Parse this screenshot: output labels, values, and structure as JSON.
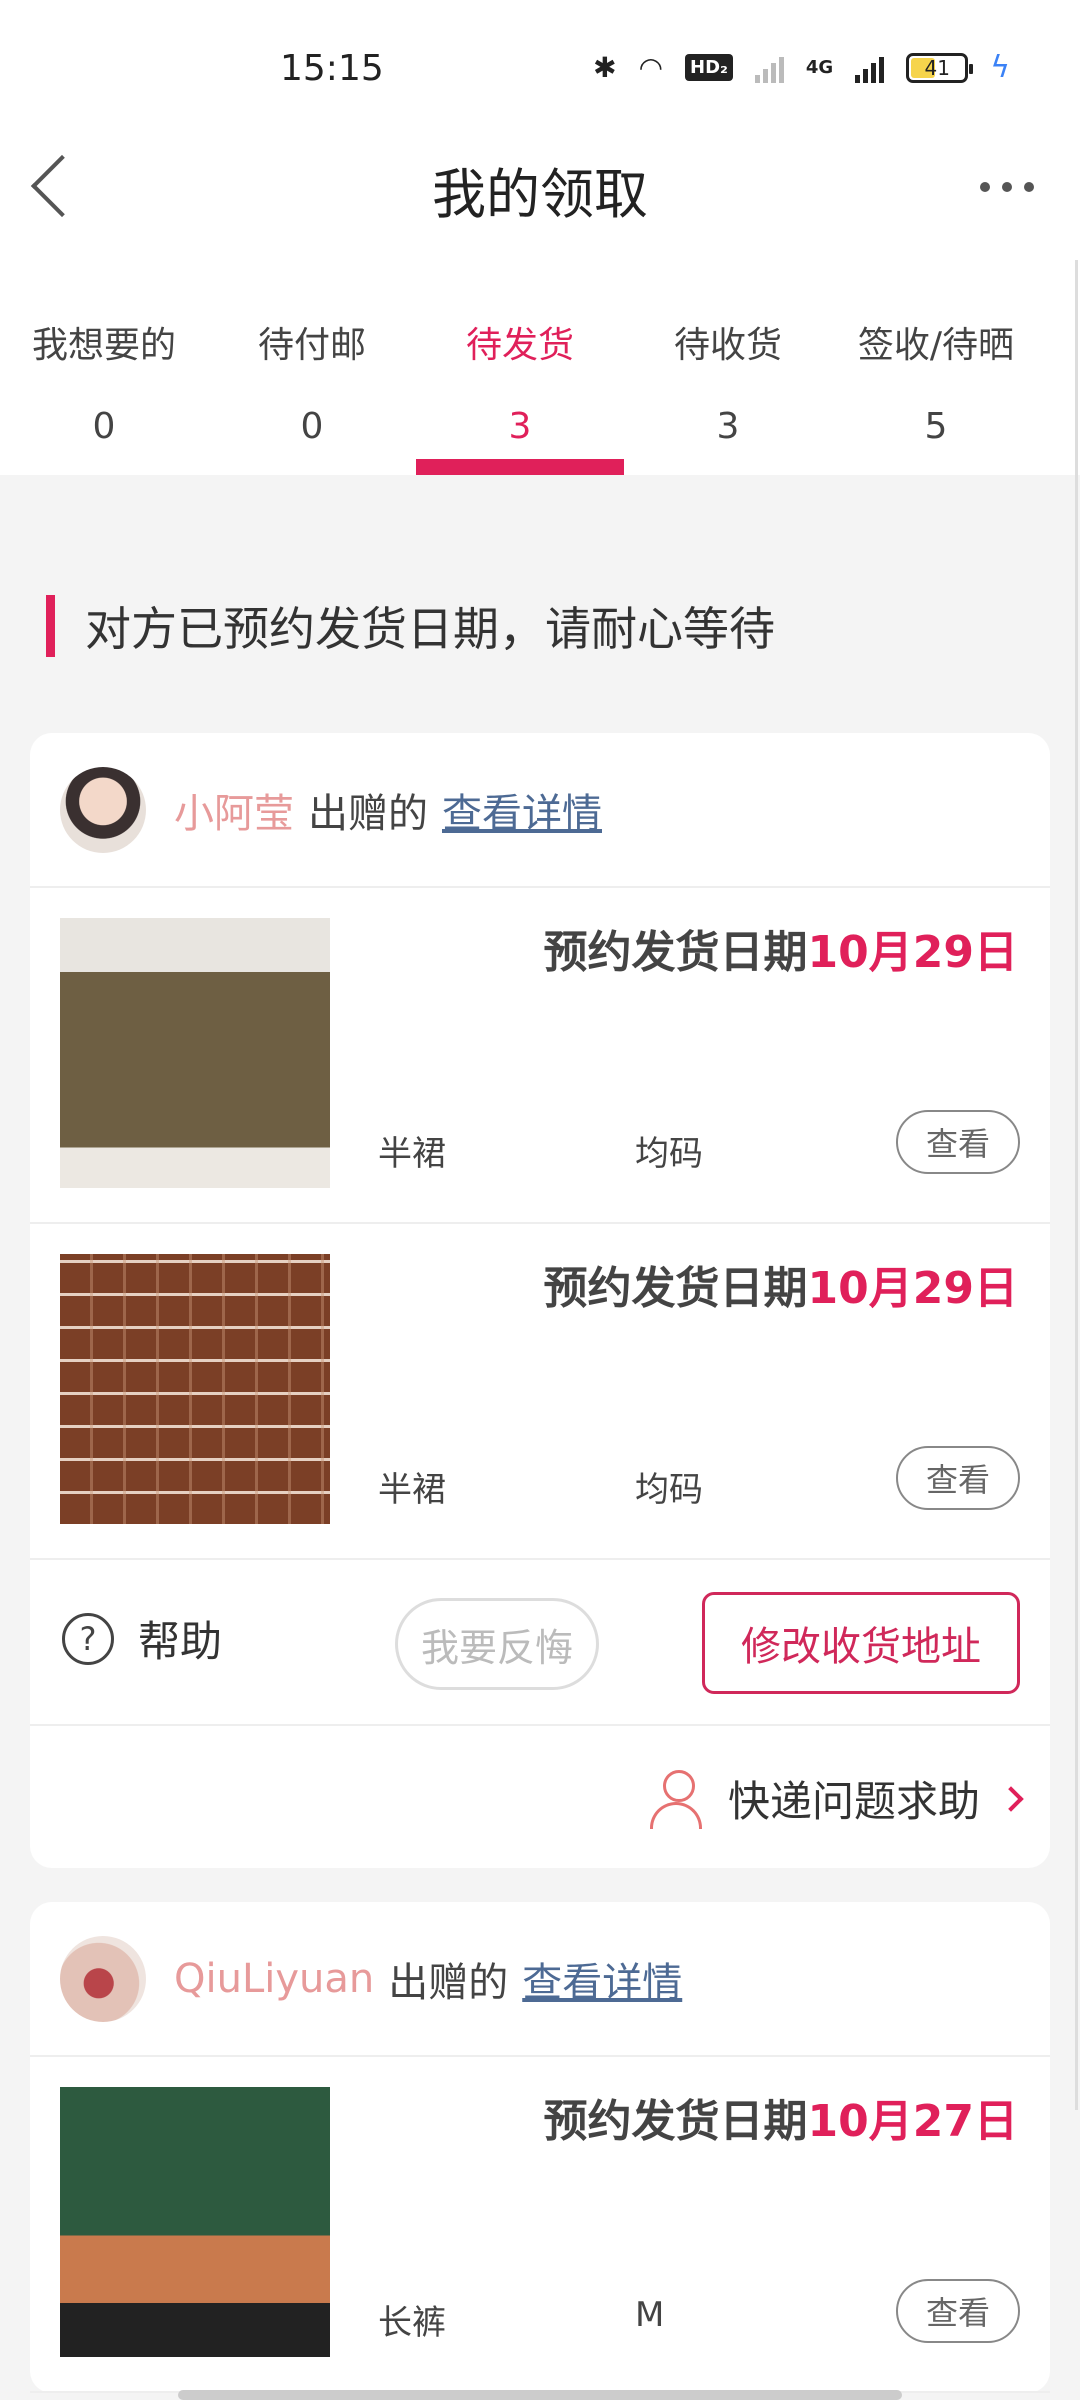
{
  "status_bar": {
    "time": "15:15",
    "hd_badge": "HD₂",
    "network": "4G",
    "battery": "41",
    "icons": [
      "bluetooth-icon",
      "wifi-icon",
      "signal-icon",
      "battery-icon",
      "charging-icon"
    ]
  },
  "header": {
    "title": "我的领取"
  },
  "tabs": [
    {
      "label": "我想要的",
      "count": "0"
    },
    {
      "label": "待付邮",
      "count": "0"
    },
    {
      "label": "待发货",
      "count": "3",
      "active": true
    },
    {
      "label": "待收货",
      "count": "3"
    },
    {
      "label": "签收/待晒",
      "count": "5"
    }
  ],
  "notice": "对方已预约发货日期，请耐心等待",
  "colors": {
    "accent": "#e0205a",
    "giver_name": "#e79a9a",
    "link": "#4d6a94"
  },
  "cards": [
    {
      "giver": "小阿莹",
      "gave_text": "出赠的",
      "detail_link": "查看详情",
      "items": [
        {
          "ship_label": "预约发货日期",
          "ship_date": "10月29日",
          "category": "半裙",
          "size": "均码",
          "view_label": "查看"
        },
        {
          "ship_label": "预约发货日期",
          "ship_date": "10月29日",
          "category": "半裙",
          "size": "均码",
          "view_label": "查看"
        }
      ],
      "help_label": "帮助",
      "regret_label": "我要反悔",
      "address_label": "修改收货地址",
      "express_label": "快递问题求助"
    },
    {
      "giver": "QiuLiyuan",
      "gave_text": "出赠的",
      "detail_link": "查看详情",
      "items": [
        {
          "ship_label": "预约发货日期",
          "ship_date": "10月27日",
          "category": "长裤",
          "size": "M",
          "view_label": "查看"
        }
      ]
    }
  ]
}
